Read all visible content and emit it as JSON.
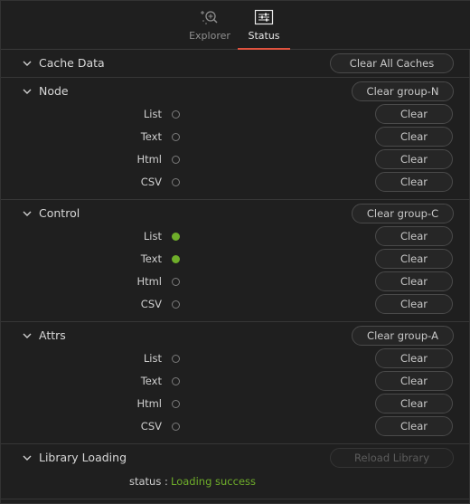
{
  "tabs": [
    {
      "label": "Explorer",
      "icon": "explorer-magnify-icon",
      "active": false
    },
    {
      "label": "Status",
      "icon": "sliders-icon",
      "active": true
    }
  ],
  "colors": {
    "active_tab_underline": "#e0533f",
    "status_on": "#6fae2a",
    "success_text": "#6fae2a"
  },
  "cache": {
    "title": "Cache Data",
    "clear_all_label": "Clear All Caches"
  },
  "node": {
    "title": "Node",
    "clear_group_label": "Clear group-N",
    "rows": [
      {
        "label": "List",
        "on": false,
        "button": "Clear"
      },
      {
        "label": "Text",
        "on": false,
        "button": "Clear"
      },
      {
        "label": "Html",
        "on": false,
        "button": "Clear"
      },
      {
        "label": "CSV",
        "on": false,
        "button": "Clear"
      }
    ]
  },
  "control": {
    "title": "Control",
    "clear_group_label": "Clear group-C",
    "rows": [
      {
        "label": "List",
        "on": true,
        "button": "Clear"
      },
      {
        "label": "Text",
        "on": true,
        "button": "Clear"
      },
      {
        "label": "Html",
        "on": false,
        "button": "Clear"
      },
      {
        "label": "CSV",
        "on": false,
        "button": "Clear"
      }
    ]
  },
  "attrs": {
    "title": "Attrs",
    "clear_group_label": "Clear group-A",
    "rows": [
      {
        "label": "List",
        "on": false,
        "button": "Clear"
      },
      {
        "label": "Text",
        "on": false,
        "button": "Clear"
      },
      {
        "label": "Html",
        "on": false,
        "button": "Clear"
      },
      {
        "label": "CSV",
        "on": false,
        "button": "Clear"
      }
    ]
  },
  "library": {
    "title": "Library Loading",
    "reload_label": "Reload Library",
    "status_label": "status :",
    "status_value": "Loading success"
  }
}
